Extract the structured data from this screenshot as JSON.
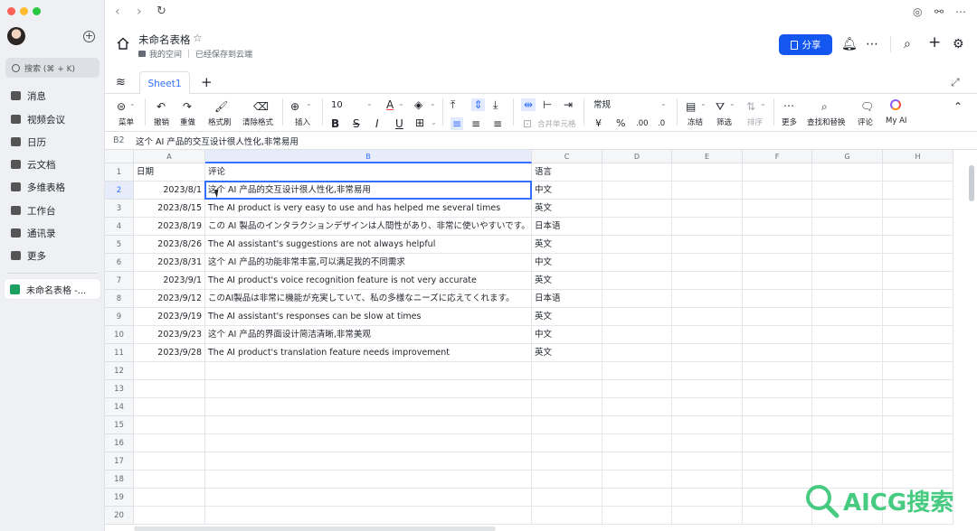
{
  "sidebar": {
    "search_label": "搜索 (⌘ + K)",
    "nav_items": [
      "消息",
      "视频会议",
      "日历",
      "云文档",
      "多维表格",
      "工作台",
      "通讯录",
      "更多"
    ],
    "open_doc": "未命名表格 -..."
  },
  "header": {
    "title": "未命名表格",
    "location": "我的空间",
    "save_status": "已经保存到云端",
    "share_label": "分享"
  },
  "tabs": {
    "sheet1": "Sheet1"
  },
  "toolbar": {
    "menu": "菜单",
    "undo": "撤销",
    "redo": "重做",
    "format_painter": "格式刷",
    "clear_format": "清除格式",
    "insert": "插入",
    "font_size": "10",
    "merge": "合并单元格",
    "number_format": "常规",
    "freeze": "冻结",
    "filter": "筛选",
    "sort": "排序",
    "more": "更多",
    "find_replace": "查找和替换",
    "comment": "评论",
    "my_ai": "My AI"
  },
  "formula_bar": {
    "cell_ref": "B2",
    "value": "这个 AI 产品的交互设计很人性化,非常易用"
  },
  "sheet": {
    "columns": [
      "A",
      "B",
      "C",
      "D",
      "E",
      "F",
      "G",
      "H"
    ],
    "row_numbers": [
      "1",
      "2",
      "3",
      "4",
      "5",
      "6",
      "7",
      "8",
      "9",
      "10",
      "11",
      "12",
      "13",
      "14",
      "15",
      "16",
      "17",
      "18",
      "19",
      "20"
    ],
    "rows": [
      [
        "日期",
        "评论",
        "语言"
      ],
      [
        "2023/8/1",
        "这个 AI 产品的交互设计很人性化,非常易用",
        "中文"
      ],
      [
        "2023/8/15",
        "The AI product is very easy to use and has helped me several times",
        "英文"
      ],
      [
        "2023/8/19",
        "この AI 製品のインタラクションデザインは人間性があり、非常に使いやすいです。",
        "日本语"
      ],
      [
        "2023/8/26",
        "The AI assistant's suggestions are not always helpful",
        "英文"
      ],
      [
        "2023/8/31",
        "这个 AI 产品的功能非常丰富,可以满足我的不同需求",
        "中文"
      ],
      [
        "2023/9/1",
        "The AI product's voice recognition feature is not very accurate",
        "英文"
      ],
      [
        "2023/9/12",
        "このAI製品は非常に機能が充実していて、私の多様なニーズに応えてくれます。",
        "日本语"
      ],
      [
        "2023/9/19",
        "The AI assistant's responses can be slow at times",
        "英文"
      ],
      [
        "2023/9/23",
        "这个 AI 产品的界面设计简洁清晰,非常美观",
        "中文"
      ],
      [
        "2023/9/28",
        "The AI product's translation feature needs improvement",
        "英文"
      ]
    ]
  },
  "watermark": "AICG搜索",
  "colors": {
    "accent": "#3370ff",
    "share": "#1456f0",
    "watermark": "#27c26a"
  }
}
